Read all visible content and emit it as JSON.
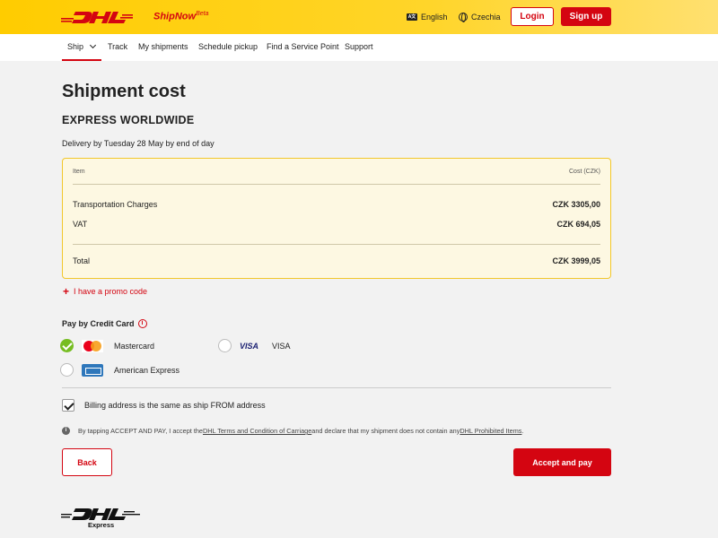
{
  "header": {
    "brand_sub": "ShipNow",
    "brand_beta": "Beta",
    "language_icon": "A文",
    "language": "English",
    "country": "Czechia",
    "login_label": "Login",
    "signup_label": "Sign up"
  },
  "nav": {
    "items": [
      "Ship",
      "Track",
      "My shipments",
      "Schedule pickup",
      "Find a Service Point",
      "Support"
    ],
    "active": "Ship"
  },
  "main": {
    "title": "Shipment cost",
    "product": "EXPRESS WORLDWIDE",
    "delivery": "Delivery by Tuesday 28 May by end of day"
  },
  "cost": {
    "col_item": "Item",
    "col_cost": "Cost (CZK)",
    "rows": [
      {
        "label": "Transportation Charges",
        "value": "CZK 3305,00"
      },
      {
        "label": "VAT",
        "value": "CZK 694,05"
      }
    ],
    "total_label": "Total",
    "total_value": "CZK 3999,05"
  },
  "promo_label": "I have a promo code",
  "payment": {
    "title": "Pay by Credit Card",
    "options": [
      {
        "label": "Mastercard",
        "icon": "mastercard-logo",
        "selected": true
      },
      {
        "label": "VISA",
        "icon": "visa-logo",
        "logo_text": "VISA",
        "selected": false
      },
      {
        "label": "American Express",
        "icon": "amex-logo",
        "selected": false
      }
    ]
  },
  "billing_label": "Billing address is the same as ship FROM address",
  "billing_checked": true,
  "terms": {
    "pre": "By tapping ACCEPT AND PAY, I accept the ",
    "link1": "DHL Terms and Condition of Carriage",
    "mid": " and declare that my shipment does not contain any ",
    "link2": "DHL Prohibited Items",
    "post": "."
  },
  "buttons": {
    "back": "Back",
    "accept": "Accept and pay"
  },
  "footer": {
    "brand_sub": "Express"
  },
  "colors": {
    "brand_red": "#d40511",
    "brand_yellow": "#ffcc00",
    "success_green": "#76bd22"
  }
}
